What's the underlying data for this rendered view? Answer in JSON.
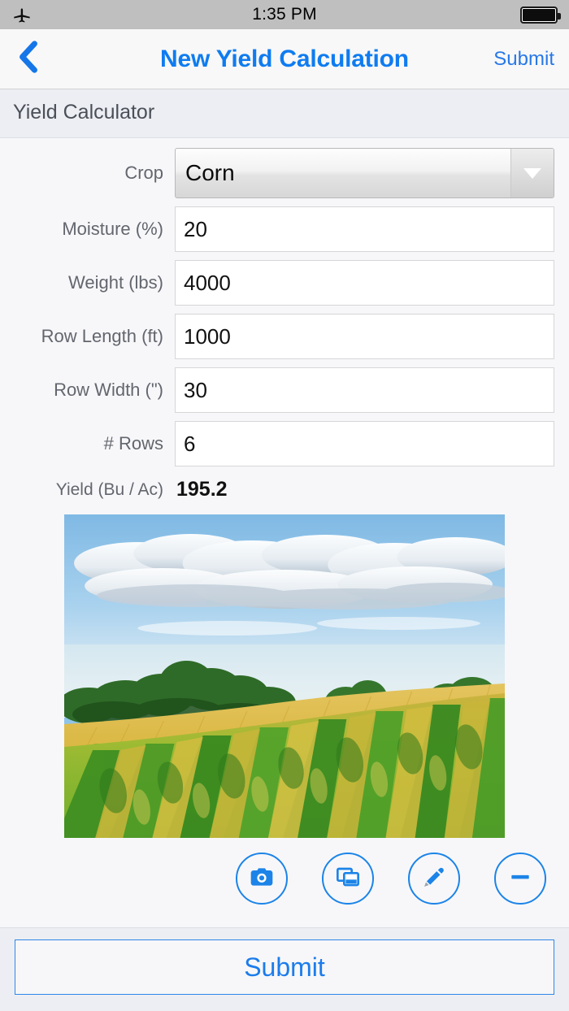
{
  "status_bar": {
    "airplane_icon": "airplane-icon",
    "time": "1:35 PM",
    "battery_icon": "battery-full-icon"
  },
  "nav_bar": {
    "back_icon": "chevron-left-icon",
    "title": "New Yield Calculation",
    "action_label": "Submit"
  },
  "section": {
    "header": "Yield Calculator"
  },
  "form": {
    "crop": {
      "label": "Crop",
      "value": "Corn",
      "dropdown_icon": "chevron-down-icon"
    },
    "fields": [
      {
        "label": "Moisture (%)",
        "value": "20"
      },
      {
        "label": "Weight (lbs)",
        "value": "4000"
      },
      {
        "label": "Row Length (ft)",
        "value": "1000"
      },
      {
        "label": "Row Width (\")",
        "value": "30"
      },
      {
        "label": "# Rows",
        "value": "6"
      }
    ],
    "result": {
      "label": "Yield (Bu / Ac)",
      "value": "195.2"
    }
  },
  "photo": {
    "alt": "corn-field-photo"
  },
  "photo_actions": [
    {
      "name": "camera-button",
      "icon": "camera-icon"
    },
    {
      "name": "photo-library-button",
      "icon": "photo-stack-icon"
    },
    {
      "name": "edit-button",
      "icon": "pencil-icon"
    },
    {
      "name": "remove-button",
      "icon": "minus-icon"
    }
  ],
  "bottom": {
    "submit_label": "Submit"
  },
  "colors": {
    "accent_blue": "#0f7cf0",
    "link_blue": "#2878e8",
    "icon_blue": "#1c84e8",
    "status_bar_bg": "#bfbfbf",
    "nav_bg": "#f8f8f8",
    "section_bg": "#eceef3",
    "page_bg": "#f7f7f9",
    "label_gray": "#63666e"
  }
}
